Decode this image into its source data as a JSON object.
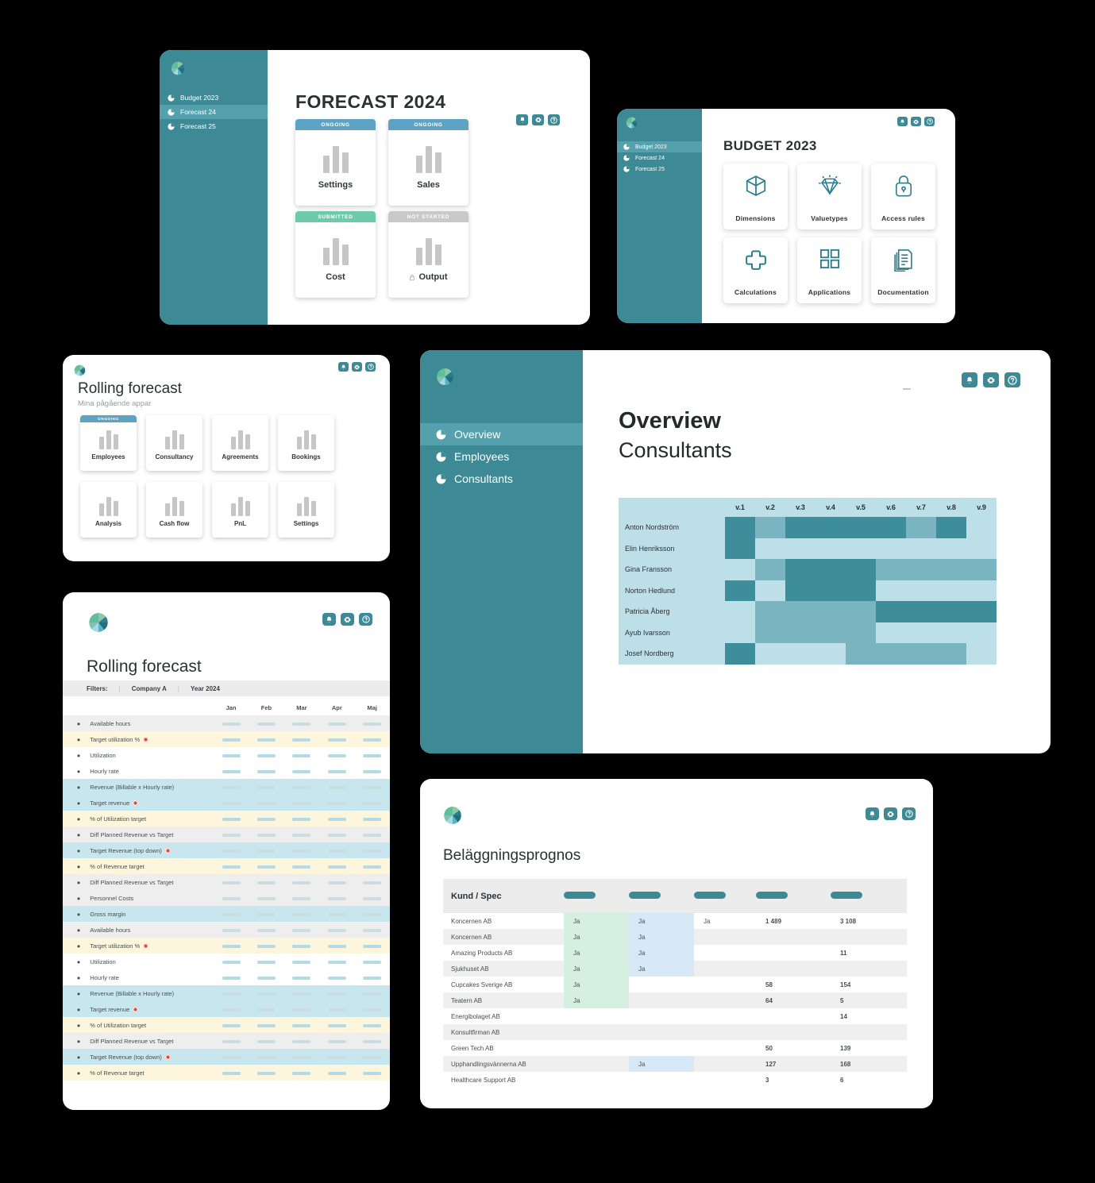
{
  "brand": {
    "accent": "#3d8a96",
    "accent_light": "#54a0ad",
    "ongoing": "#5fa3c4",
    "submitted": "#6ccbaa",
    "notstarted": "#c9c9c9"
  },
  "topbar_icons": [
    {
      "name": "bell-icon",
      "glyph": "🔔"
    },
    {
      "name": "gear-icon",
      "glyph": "⚙"
    },
    {
      "name": "help-icon",
      "glyph": "?"
    }
  ],
  "forecast_panel": {
    "title": "FORECAST 2024",
    "sidebar": [
      {
        "label": "Budget 2023",
        "active": false
      },
      {
        "label": "Forecast 24",
        "active": true
      },
      {
        "label": "Forecast 25",
        "active": false
      }
    ],
    "tiles": [
      {
        "label": "Settings",
        "status": "ONGOING",
        "state": "ongoing",
        "locked": false
      },
      {
        "label": "Sales",
        "status": "ONGOING",
        "state": "ongoing",
        "locked": false
      },
      {
        "label": "Cost",
        "status": "SUBMITTED",
        "state": "submitted",
        "locked": false
      },
      {
        "label": "Output",
        "status": "NOT STARTED",
        "state": "notstarted",
        "locked": true
      }
    ]
  },
  "budget_panel": {
    "title": "BUDGET 2023",
    "sidebar": [
      {
        "label": "Budget 2023",
        "active": true
      },
      {
        "label": "Forecast 24",
        "active": false
      },
      {
        "label": "Forecast 25",
        "active": false
      }
    ],
    "tiles": [
      {
        "label": "Dimensions",
        "icon": "cube-icon"
      },
      {
        "label": "Valuetypes",
        "icon": "diamond-icon"
      },
      {
        "label": "Access rules",
        "icon": "lock-icon"
      },
      {
        "label": "Calculations",
        "icon": "plus-icon"
      },
      {
        "label": "Applications",
        "icon": "grid-icon"
      },
      {
        "label": "Documentation",
        "icon": "documents-icon"
      }
    ]
  },
  "apps_panel": {
    "title": "Rolling forecast",
    "subtitle": "Mina pågående appar",
    "tiles": [
      {
        "label": "Employees",
        "status": "ONGOING",
        "state": "ongoing"
      },
      {
        "label": "Consultancy",
        "status": "",
        "state": "none"
      },
      {
        "label": "Agreements",
        "status": "",
        "state": "none"
      },
      {
        "label": "Bookings",
        "status": "",
        "state": "none"
      },
      {
        "label": "Analysis",
        "status": "",
        "state": "none"
      },
      {
        "label": "Cash flow",
        "status": "",
        "state": "none"
      },
      {
        "label": "PnL",
        "status": "",
        "state": "none"
      },
      {
        "label": "Settings",
        "status": "",
        "state": "none"
      }
    ]
  },
  "overview_panel": {
    "sidebar": [
      {
        "label": "Overview",
        "active": true
      },
      {
        "label": "Employees",
        "active": false
      },
      {
        "label": "Consultants",
        "active": false
      }
    ],
    "title": "Overview",
    "subtitle": "Consultants",
    "chart_data": {
      "type": "heatmap",
      "title": "Consultants",
      "xlabel": "",
      "ylabel": "",
      "legend": "",
      "levels": {
        "0": "#bcdfe8",
        "1": "#7bb4c1",
        "2": "#3d8d9a"
      },
      "categories": [
        "v.1",
        "v.2",
        "v.3",
        "v.4",
        "v.5",
        "v.6",
        "v.7",
        "v.8",
        "v.9"
      ],
      "rows": [
        "Anton Nordström",
        "Elin Henriksson",
        "Gina Fransson",
        "Norton Hedlund",
        "Patricia Åberg",
        "Ayub Ivarsson",
        "Josef Nordberg"
      ],
      "values": [
        [
          2,
          1,
          2,
          2,
          2,
          2,
          1,
          2,
          0
        ],
        [
          2,
          0,
          0,
          0,
          0,
          0,
          0,
          0,
          0
        ],
        [
          0,
          1,
          2,
          2,
          2,
          1,
          1,
          1,
          1
        ],
        [
          2,
          0,
          2,
          2,
          2,
          0,
          0,
          0,
          0
        ],
        [
          0,
          1,
          1,
          1,
          1,
          2,
          2,
          2,
          2
        ],
        [
          0,
          1,
          1,
          1,
          1,
          0,
          0,
          0,
          0
        ],
        [
          2,
          0,
          0,
          0,
          1,
          1,
          1,
          1,
          0
        ]
      ]
    }
  },
  "rf_panel": {
    "title": "Rolling forecast",
    "filters": {
      "label": "Filters:",
      "company": "Company A",
      "year": "Year 2024"
    },
    "months": [
      "Jan",
      "Feb",
      "Mar",
      "Apr",
      "Maj"
    ],
    "rows": [
      {
        "label": "Available hours",
        "tone": "gray",
        "target": false
      },
      {
        "label": "Target utilization %",
        "tone": "yellow",
        "target": true
      },
      {
        "label": "Utilization",
        "tone": "white",
        "target": false
      },
      {
        "label": "Hourly rate",
        "tone": "white",
        "target": false
      },
      {
        "label": "Revenue (Billable x Hourly rate)",
        "tone": "blue",
        "target": false
      },
      {
        "label": "Target revenue",
        "tone": "blue",
        "target": true
      },
      {
        "label": "% of Utilization target",
        "tone": "yellow",
        "target": false
      },
      {
        "label": "Diff Planned Revenue vs Target",
        "tone": "gray",
        "target": false
      },
      {
        "label": "Target Revenue (top down)",
        "tone": "blue",
        "target": true
      },
      {
        "label": "% of Revenue target",
        "tone": "yellow",
        "target": false
      },
      {
        "label": "Diff Planned Revenue vs Target",
        "tone": "gray",
        "target": false
      },
      {
        "label": "Personnel Costs",
        "tone": "gray",
        "target": false
      },
      {
        "label": "Gross margin",
        "tone": "blue",
        "target": false
      },
      {
        "label": "Available hours",
        "tone": "gray",
        "target": false
      },
      {
        "label": "Target utilization %",
        "tone": "yellow",
        "target": true
      },
      {
        "label": "Utilization",
        "tone": "white",
        "target": false
      },
      {
        "label": "Hourly rate",
        "tone": "white",
        "target": false
      },
      {
        "label": "Revenue (Billable x Hourly rate)",
        "tone": "blue",
        "target": false
      },
      {
        "label": "Target revenue",
        "tone": "blue",
        "target": true
      },
      {
        "label": "% of Utilization target",
        "tone": "yellow",
        "target": false
      },
      {
        "label": "Diff Planned Revenue vs Target",
        "tone": "gray",
        "target": false
      },
      {
        "label": "Target Revenue (top down)",
        "tone": "blue",
        "target": true
      },
      {
        "label": "% of Revenue target",
        "tone": "yellow",
        "target": false
      }
    ]
  },
  "bel_panel": {
    "title": "Beläggningsprognos",
    "header": {
      "first": "Kund / Spec",
      "pills": 5
    },
    "rows": [
      {
        "name": "Koncernen AB",
        "c1": "Ja",
        "c2": "Ja",
        "c3": "Ja",
        "c4": "1 489",
        "c5": "3 108"
      },
      {
        "name": "Koncernen AB",
        "c1": "Ja",
        "c2": "Ja",
        "c3": "",
        "c4": "",
        "c5": ""
      },
      {
        "name": "Amazing Products AB",
        "c1": "Ja",
        "c2": "Ja",
        "c3": "",
        "c4": "",
        "c5": "11"
      },
      {
        "name": "Sjukhuset AB",
        "c1": "Ja",
        "c2": "Ja",
        "c3": "",
        "c4": "",
        "c5": ""
      },
      {
        "name": "Cupcakes Sverige AB",
        "c1": "Ja",
        "c2": "",
        "c3": "",
        "c4": "58",
        "c5": "154"
      },
      {
        "name": "Teatern AB",
        "c1": "Ja",
        "c2": "",
        "c3": "",
        "c4": "64",
        "c5": "5"
      },
      {
        "name": "Energibolaget AB",
        "c1": "",
        "c2": "",
        "c3": "",
        "c4": "",
        "c5": "14"
      },
      {
        "name": "Konsultfirman AB",
        "c1": "",
        "c2": "",
        "c3": "",
        "c4": "",
        "c5": ""
      },
      {
        "name": "Green Tech AB",
        "c1": "",
        "c2": "",
        "c3": "",
        "c4": "50",
        "c5": "139"
      },
      {
        "name": "Upphandlingsvännerna AB",
        "c1": "",
        "c2": "Ja",
        "c3": "",
        "c4": "127",
        "c5": "168"
      },
      {
        "name": "Healthcare Support AB",
        "c1": "",
        "c2": "",
        "c3": "",
        "c4": "3",
        "c5": "6"
      }
    ]
  }
}
